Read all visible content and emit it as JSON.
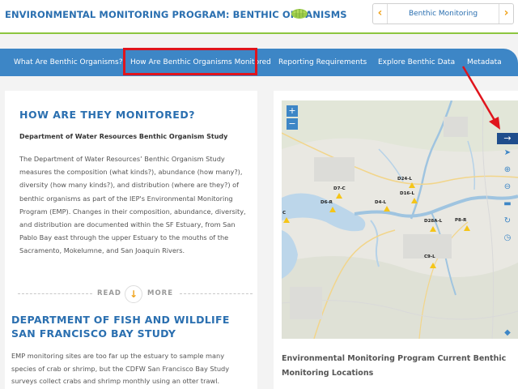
{
  "header": {
    "site_title": "ENVIRONMENTAL MONITORING PROGRAM: BENTHIC ORGANISMS",
    "pager_label": "Benthic Monitoring",
    "pager_prev_icon": "chevron-left-icon",
    "pager_next_icon": "chevron-right-icon"
  },
  "nav": {
    "items": [
      {
        "label": "What Are Benthic Organisms?"
      },
      {
        "label": "How Are Benthic Organisms Monitored"
      },
      {
        "label": "Reporting Requirements"
      },
      {
        "label": "Explore Benthic Data"
      },
      {
        "label": "Metadata"
      }
    ],
    "active_index": 1
  },
  "left": {
    "heading": "HOW ARE THEY MONITORED?",
    "subheading": "Department of Water Resources Benthic Organism Study",
    "body": "The Department of Water Resources’ Benthic Organism Study measures the composition (what kinds?), abundance (how many?), diversity (how many kinds?), and distribution (where are they?) of benthic organisms as part of the IEP's Environmental Monitoring Program (EMP). Changes in their composition, abundance, diversity, and distribution are documented within the SF Estuary, from San Pablo Bay east through the upper Estuary to the mouths of the Sacramento, Mokelumne, and San Joaquin Rivers.",
    "read_label": "READ",
    "more_label": "MORE",
    "heading2": "DEPARTMENT OF FISH AND WILDLIFE SAN FRANCISCO BAY STUDY",
    "body2": "EMP monitoring sites are too far up the estuary to sample many species of crab or shrimp, but the CDFW San Francisco Bay Study surveys collect crabs and shrimp monthly using an otter trawl."
  },
  "map": {
    "zoom_in": "+",
    "zoom_out": "−",
    "sites": [
      {
        "label": "D24-L"
      },
      {
        "label": "D7-C"
      },
      {
        "label": "D16-L"
      },
      {
        "label": "D6-R"
      },
      {
        "label": "D4-L"
      },
      {
        "label": "C"
      },
      {
        "label": "D28A-L"
      },
      {
        "label": "P8-R"
      },
      {
        "label": "C9-L"
      }
    ],
    "tools": [
      "arrow-right-icon",
      "pointer-icon",
      "zoom-in-icon",
      "zoom-out-icon",
      "ruler-icon",
      "refresh-icon",
      "clock-icon",
      "layers-icon"
    ],
    "caption": "Environmental Monitoring Program Current Benthic Monitoring Locations"
  },
  "colors": {
    "brand_blue": "#2a6fb0",
    "nav_blue": "#3d86c6",
    "accent_orange": "#f0a31c",
    "green_rule": "#8cc63f",
    "highlight_red": "#e0141c",
    "site_marker": "#f5c518"
  }
}
